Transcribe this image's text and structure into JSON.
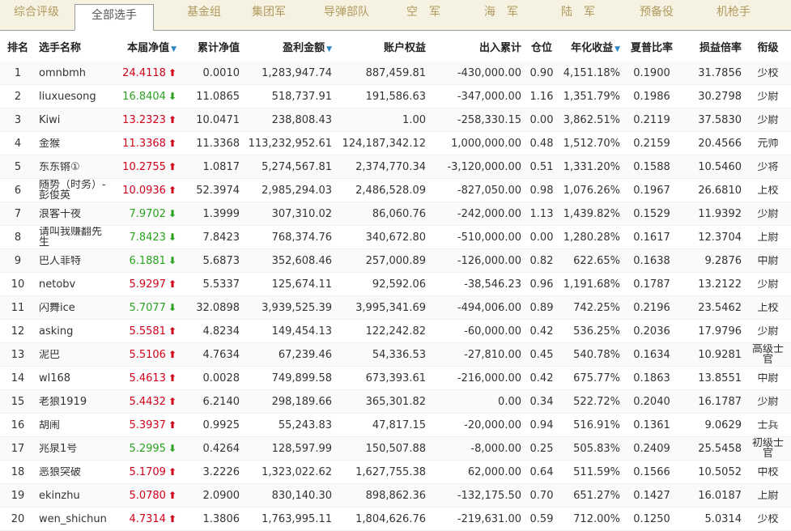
{
  "tabs": [
    "综合评级",
    "全部选手",
    "基金组",
    "集团军",
    "导弹部队",
    "空　军",
    "海　军",
    "陆　军",
    "预备役",
    "机枪手"
  ],
  "headers": {
    "rank": "排名",
    "name": "选手名称",
    "nav": "本届净值",
    "cum": "累计净值",
    "profit": "盈利金额",
    "equity": "账户权益",
    "flow": "出入累计",
    "pos": "仓位",
    "annual": "年化收益",
    "sharpe": "夏普比率",
    "ratio": "损益倍率",
    "title": "衔级",
    "sort_mark": "▼"
  },
  "colors": {
    "up": "#d0021b",
    "down": "#2aa21f",
    "tab_text": "#b09a5e"
  },
  "rows": [
    {
      "rank": "1",
      "name": "omnbmh",
      "nav": "24.4118",
      "dir": "up",
      "cum": "0.0010",
      "profit": "1,283,947.74",
      "equity": "887,459.81",
      "flow": "-430,000.00",
      "pos": "0.90",
      "annual": "4,151.18%",
      "sharpe": "0.1900",
      "ratio": "31.7856",
      "title": "少校"
    },
    {
      "rank": "2",
      "name": "liuxuesong",
      "nav": "16.8404",
      "dir": "down",
      "cum": "11.0865",
      "profit": "518,737.91",
      "equity": "191,586.63",
      "flow": "-347,000.00",
      "pos": "1.16",
      "annual": "1,351.79%",
      "sharpe": "0.1986",
      "ratio": "30.2798",
      "title": "少尉"
    },
    {
      "rank": "3",
      "name": "Kiwi",
      "nav": "13.2323",
      "dir": "up",
      "cum": "10.0471",
      "profit": "238,808.43",
      "equity": "1.00",
      "flow": "-258,330.15",
      "pos": "0.00",
      "annual": "3,862.51%",
      "sharpe": "0.2119",
      "ratio": "37.5830",
      "title": "少尉"
    },
    {
      "rank": "4",
      "name": "金猴",
      "nav": "11.3368",
      "dir": "up",
      "cum": "11.3368",
      "profit": "113,232,952.61",
      "equity": "124,187,342.12",
      "flow": "1,000,000.00",
      "pos": "0.48",
      "annual": "1,512.70%",
      "sharpe": "0.2159",
      "ratio": "20.4566",
      "title": "元帅"
    },
    {
      "rank": "5",
      "name": "东东锵①",
      "nav": "10.2755",
      "dir": "up",
      "cum": "1.0817",
      "profit": "5,274,567.81",
      "equity": "2,374,770.34",
      "flow": "-3,120,000.00",
      "pos": "0.51",
      "annual": "1,331.20%",
      "sharpe": "0.1588",
      "ratio": "10.5460",
      "title": "少将"
    },
    {
      "rank": "6",
      "name": "随势（时务）-彭俊英",
      "nav": "10.0936",
      "dir": "up",
      "cum": "52.3974",
      "profit": "2,985,294.03",
      "equity": "2,486,528.09",
      "flow": "-827,050.00",
      "pos": "0.98",
      "annual": "1,076.26%",
      "sharpe": "0.1967",
      "ratio": "26.6810",
      "title": "上校"
    },
    {
      "rank": "7",
      "name": "浪客十夜",
      "nav": "7.9702",
      "dir": "down",
      "cum": "1.3999",
      "profit": "307,310.02",
      "equity": "86,060.76",
      "flow": "-242,000.00",
      "pos": "1.13",
      "annual": "1,439.82%",
      "sharpe": "0.1529",
      "ratio": "11.9392",
      "title": "少尉"
    },
    {
      "rank": "8",
      "name": "请叫我赚翻先生",
      "nav": "7.8423",
      "dir": "down",
      "cum": "7.8423",
      "profit": "768,374.76",
      "equity": "340,672.80",
      "flow": "-510,000.00",
      "pos": "0.00",
      "annual": "1,280.28%",
      "sharpe": "0.1617",
      "ratio": "12.3704",
      "title": "上尉"
    },
    {
      "rank": "9",
      "name": "巴人菲特",
      "nav": "6.1881",
      "dir": "down",
      "cum": "5.6873",
      "profit": "352,608.46",
      "equity": "257,000.89",
      "flow": "-126,000.00",
      "pos": "0.82",
      "annual": "622.65%",
      "sharpe": "0.1638",
      "ratio": "9.2876",
      "title": "中尉"
    },
    {
      "rank": "10",
      "name": "netobv",
      "nav": "5.9297",
      "dir": "up",
      "cum": "5.5337",
      "profit": "125,674.11",
      "equity": "92,592.06",
      "flow": "-38,546.23",
      "pos": "0.96",
      "annual": "1,191.68%",
      "sharpe": "0.1787",
      "ratio": "13.2122",
      "title": "少尉"
    },
    {
      "rank": "11",
      "name": "闪舞ice",
      "nav": "5.7077",
      "dir": "down",
      "cum": "32.0898",
      "profit": "3,939,525.39",
      "equity": "3,995,341.69",
      "flow": "-494,006.00",
      "pos": "0.89",
      "annual": "742.25%",
      "sharpe": "0.2196",
      "ratio": "23.5462",
      "title": "上校"
    },
    {
      "rank": "12",
      "name": "asking",
      "nav": "5.5581",
      "dir": "up",
      "cum": "4.8234",
      "profit": "149,454.13",
      "equity": "122,242.82",
      "flow": "-60,000.00",
      "pos": "0.42",
      "annual": "536.25%",
      "sharpe": "0.2036",
      "ratio": "17.9796",
      "title": "少尉"
    },
    {
      "rank": "13",
      "name": "泥巴",
      "nav": "5.5106",
      "dir": "up",
      "cum": "4.7634",
      "profit": "67,239.46",
      "equity": "54,336.53",
      "flow": "-27,810.00",
      "pos": "0.45",
      "annual": "540.78%",
      "sharpe": "0.1634",
      "ratio": "10.9281",
      "title": "高级士官"
    },
    {
      "rank": "14",
      "name": "wl168",
      "nav": "5.4613",
      "dir": "up",
      "cum": "0.0028",
      "profit": "749,899.58",
      "equity": "673,393.61",
      "flow": "-216,000.00",
      "pos": "0.42",
      "annual": "675.77%",
      "sharpe": "0.1863",
      "ratio": "13.8551",
      "title": "中尉"
    },
    {
      "rank": "15",
      "name": "老狼1919",
      "nav": "5.4432",
      "dir": "up",
      "cum": "6.2140",
      "profit": "298,189.66",
      "equity": "365,301.82",
      "flow": "0.00",
      "pos": "0.34",
      "annual": "522.72%",
      "sharpe": "0.2040",
      "ratio": "16.1787",
      "title": "少尉"
    },
    {
      "rank": "16",
      "name": "胡闹",
      "nav": "5.3937",
      "dir": "up",
      "cum": "0.9925",
      "profit": "55,243.83",
      "equity": "47,817.15",
      "flow": "-20,000.00",
      "pos": "0.94",
      "annual": "516.91%",
      "sharpe": "0.1361",
      "ratio": "9.0629",
      "title": "士兵"
    },
    {
      "rank": "17",
      "name": "兆泉1号",
      "nav": "5.2995",
      "dir": "down",
      "cum": "0.4264",
      "profit": "128,597.99",
      "equity": "150,507.88",
      "flow": "-8,000.00",
      "pos": "0.25",
      "annual": "505.83%",
      "sharpe": "0.2409",
      "ratio": "25.5458",
      "title": "初级士官"
    },
    {
      "rank": "18",
      "name": "恶狼突破",
      "nav": "5.1709",
      "dir": "up",
      "cum": "3.2226",
      "profit": "1,323,022.62",
      "equity": "1,627,755.38",
      "flow": "62,000.00",
      "pos": "0.64",
      "annual": "511.59%",
      "sharpe": "0.1566",
      "ratio": "10.5052",
      "title": "中校"
    },
    {
      "rank": "19",
      "name": "ekinzhu",
      "nav": "5.0780",
      "dir": "up",
      "cum": "2.0900",
      "profit": "830,140.30",
      "equity": "898,862.36",
      "flow": "-132,175.50",
      "pos": "0.70",
      "annual": "651.27%",
      "sharpe": "0.1427",
      "ratio": "16.0187",
      "title": "上尉"
    },
    {
      "rank": "20",
      "name": "wen_shichun",
      "nav": "4.7314",
      "dir": "up",
      "cum": "1.3806",
      "profit": "1,763,995.11",
      "equity": "1,804,626.76",
      "flow": "-219,631.00",
      "pos": "0.59",
      "annual": "712.00%",
      "sharpe": "0.1250",
      "ratio": "5.0314",
      "title": "少校"
    }
  ]
}
